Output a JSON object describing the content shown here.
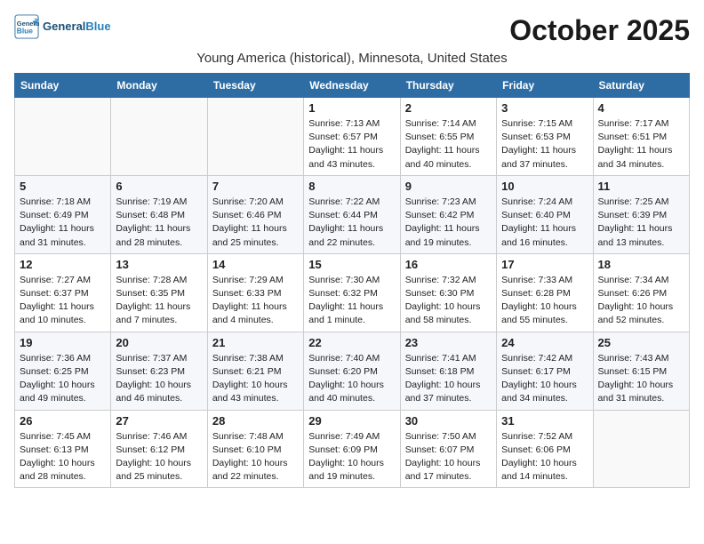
{
  "header": {
    "logo_line1": "General",
    "logo_line2": "Blue",
    "month_title": "October 2025",
    "location": "Young America (historical), Minnesota, United States"
  },
  "weekdays": [
    "Sunday",
    "Monday",
    "Tuesday",
    "Wednesday",
    "Thursday",
    "Friday",
    "Saturday"
  ],
  "weeks": [
    [
      {
        "day": "",
        "info": ""
      },
      {
        "day": "",
        "info": ""
      },
      {
        "day": "",
        "info": ""
      },
      {
        "day": "1",
        "info": "Sunrise: 7:13 AM\nSunset: 6:57 PM\nDaylight: 11 hours\nand 43 minutes."
      },
      {
        "day": "2",
        "info": "Sunrise: 7:14 AM\nSunset: 6:55 PM\nDaylight: 11 hours\nand 40 minutes."
      },
      {
        "day": "3",
        "info": "Sunrise: 7:15 AM\nSunset: 6:53 PM\nDaylight: 11 hours\nand 37 minutes."
      },
      {
        "day": "4",
        "info": "Sunrise: 7:17 AM\nSunset: 6:51 PM\nDaylight: 11 hours\nand 34 minutes."
      }
    ],
    [
      {
        "day": "5",
        "info": "Sunrise: 7:18 AM\nSunset: 6:49 PM\nDaylight: 11 hours\nand 31 minutes."
      },
      {
        "day": "6",
        "info": "Sunrise: 7:19 AM\nSunset: 6:48 PM\nDaylight: 11 hours\nand 28 minutes."
      },
      {
        "day": "7",
        "info": "Sunrise: 7:20 AM\nSunset: 6:46 PM\nDaylight: 11 hours\nand 25 minutes."
      },
      {
        "day": "8",
        "info": "Sunrise: 7:22 AM\nSunset: 6:44 PM\nDaylight: 11 hours\nand 22 minutes."
      },
      {
        "day": "9",
        "info": "Sunrise: 7:23 AM\nSunset: 6:42 PM\nDaylight: 11 hours\nand 19 minutes."
      },
      {
        "day": "10",
        "info": "Sunrise: 7:24 AM\nSunset: 6:40 PM\nDaylight: 11 hours\nand 16 minutes."
      },
      {
        "day": "11",
        "info": "Sunrise: 7:25 AM\nSunset: 6:39 PM\nDaylight: 11 hours\nand 13 minutes."
      }
    ],
    [
      {
        "day": "12",
        "info": "Sunrise: 7:27 AM\nSunset: 6:37 PM\nDaylight: 11 hours\nand 10 minutes."
      },
      {
        "day": "13",
        "info": "Sunrise: 7:28 AM\nSunset: 6:35 PM\nDaylight: 11 hours\nand 7 minutes."
      },
      {
        "day": "14",
        "info": "Sunrise: 7:29 AM\nSunset: 6:33 PM\nDaylight: 11 hours\nand 4 minutes."
      },
      {
        "day": "15",
        "info": "Sunrise: 7:30 AM\nSunset: 6:32 PM\nDaylight: 11 hours\nand 1 minute."
      },
      {
        "day": "16",
        "info": "Sunrise: 7:32 AM\nSunset: 6:30 PM\nDaylight: 10 hours\nand 58 minutes."
      },
      {
        "day": "17",
        "info": "Sunrise: 7:33 AM\nSunset: 6:28 PM\nDaylight: 10 hours\nand 55 minutes."
      },
      {
        "day": "18",
        "info": "Sunrise: 7:34 AM\nSunset: 6:26 PM\nDaylight: 10 hours\nand 52 minutes."
      }
    ],
    [
      {
        "day": "19",
        "info": "Sunrise: 7:36 AM\nSunset: 6:25 PM\nDaylight: 10 hours\nand 49 minutes."
      },
      {
        "day": "20",
        "info": "Sunrise: 7:37 AM\nSunset: 6:23 PM\nDaylight: 10 hours\nand 46 minutes."
      },
      {
        "day": "21",
        "info": "Sunrise: 7:38 AM\nSunset: 6:21 PM\nDaylight: 10 hours\nand 43 minutes."
      },
      {
        "day": "22",
        "info": "Sunrise: 7:40 AM\nSunset: 6:20 PM\nDaylight: 10 hours\nand 40 minutes."
      },
      {
        "day": "23",
        "info": "Sunrise: 7:41 AM\nSunset: 6:18 PM\nDaylight: 10 hours\nand 37 minutes."
      },
      {
        "day": "24",
        "info": "Sunrise: 7:42 AM\nSunset: 6:17 PM\nDaylight: 10 hours\nand 34 minutes."
      },
      {
        "day": "25",
        "info": "Sunrise: 7:43 AM\nSunset: 6:15 PM\nDaylight: 10 hours\nand 31 minutes."
      }
    ],
    [
      {
        "day": "26",
        "info": "Sunrise: 7:45 AM\nSunset: 6:13 PM\nDaylight: 10 hours\nand 28 minutes."
      },
      {
        "day": "27",
        "info": "Sunrise: 7:46 AM\nSunset: 6:12 PM\nDaylight: 10 hours\nand 25 minutes."
      },
      {
        "day": "28",
        "info": "Sunrise: 7:48 AM\nSunset: 6:10 PM\nDaylight: 10 hours\nand 22 minutes."
      },
      {
        "day": "29",
        "info": "Sunrise: 7:49 AM\nSunset: 6:09 PM\nDaylight: 10 hours\nand 19 minutes."
      },
      {
        "day": "30",
        "info": "Sunrise: 7:50 AM\nSunset: 6:07 PM\nDaylight: 10 hours\nand 17 minutes."
      },
      {
        "day": "31",
        "info": "Sunrise: 7:52 AM\nSunset: 6:06 PM\nDaylight: 10 hours\nand 14 minutes."
      },
      {
        "day": "",
        "info": ""
      }
    ]
  ]
}
